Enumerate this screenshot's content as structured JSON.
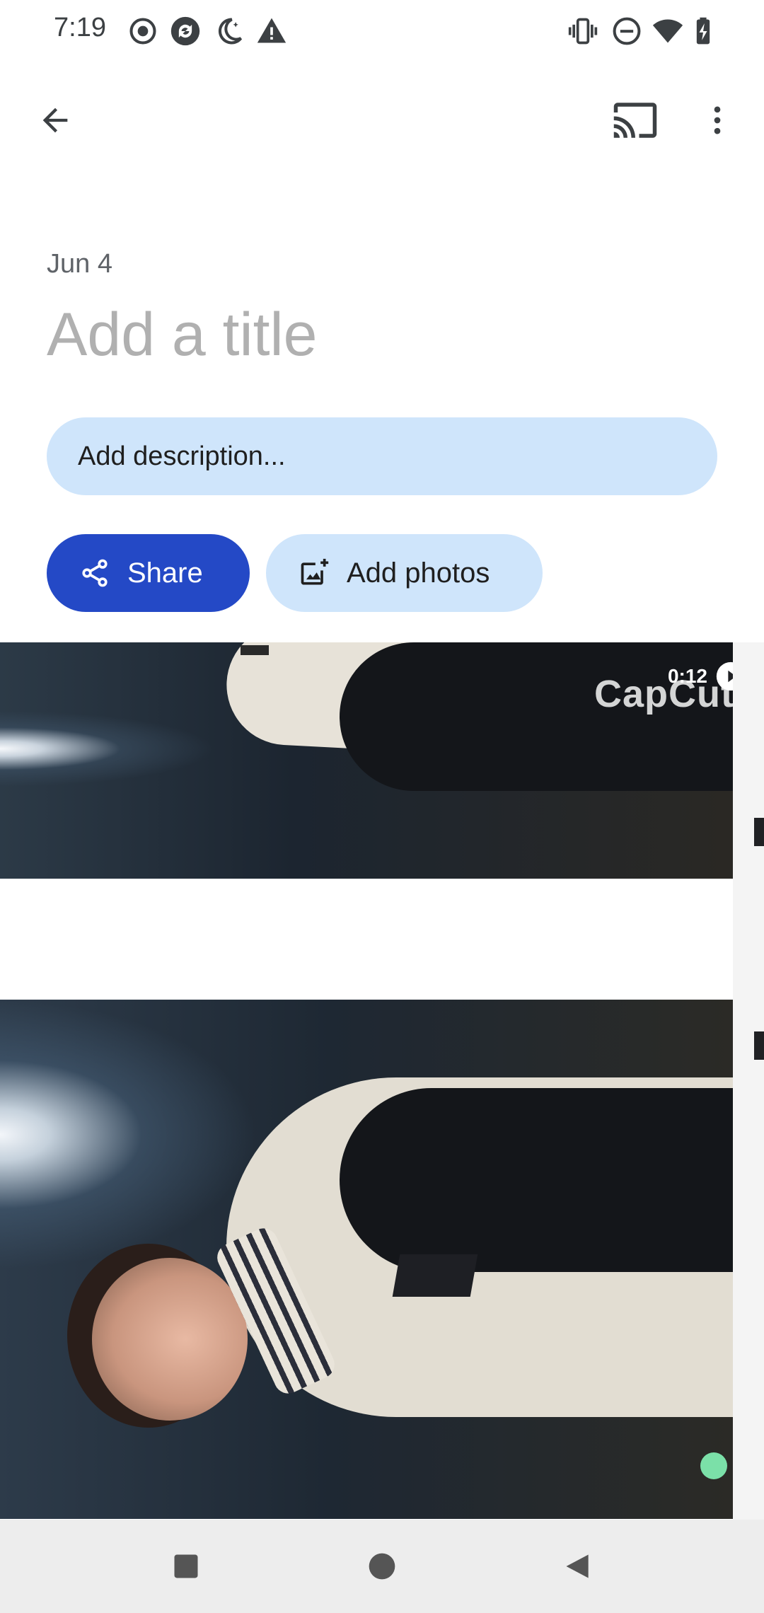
{
  "status_bar": {
    "time": "7:19",
    "left_icons": [
      "record-icon",
      "sync-icon",
      "night-mode-icon",
      "warning-icon"
    ],
    "right_icons": [
      "vibrate-icon",
      "do-not-disturb-icon",
      "wifi-icon",
      "battery-icon"
    ]
  },
  "app_bar": {
    "back_icon": "arrow-left-icon",
    "cast_icon": "cast-icon",
    "menu_icon": "more-vert-icon"
  },
  "album": {
    "date": "Jun 4",
    "title_placeholder": "Add a title",
    "description_placeholder": "Add description...",
    "share_label": "Share",
    "add_photos_label": "Add photos"
  },
  "media": {
    "video_duration": "0:12",
    "watermark": "CapCut"
  },
  "nav_bar": {
    "items": [
      "recents-square-icon",
      "home-circle-icon",
      "back-triangle-icon"
    ]
  },
  "colors": {
    "share_button": "#2449c6",
    "tonal_button": "#cfe5fb",
    "placeholder_text": "#b0b0b0"
  }
}
